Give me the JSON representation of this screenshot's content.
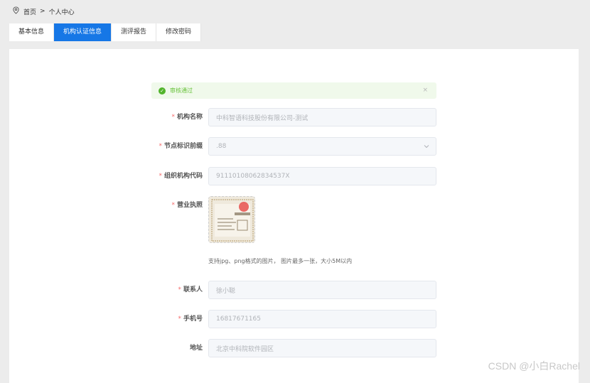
{
  "breadcrumb": {
    "home": "首页",
    "separator": ">",
    "current": "个人中心"
  },
  "tabs": [
    {
      "label": "基本信息",
      "active": false
    },
    {
      "label": "机构认证信息",
      "active": true
    },
    {
      "label": "测评报告",
      "active": false
    },
    {
      "label": "修改密码",
      "active": false
    }
  ],
  "alert": {
    "text": "审核通过",
    "close": "×"
  },
  "form": {
    "org_name": {
      "label": "机构名称",
      "required": "*",
      "value": "中科智语科技股份有限公司-测试"
    },
    "node_prefix": {
      "label": "节点标识前缀",
      "required": "*",
      "value": ".88"
    },
    "org_code": {
      "label": "组织机构代码",
      "required": "*",
      "value": "91110108062834537X"
    },
    "license": {
      "label": "营业执照",
      "required": "*",
      "hint": "支持jpg、png格式的图片， 图片最多一张，大小5M以内"
    },
    "contact": {
      "label": "联系人",
      "required": "*",
      "value": "徐小聪"
    },
    "phone": {
      "label": "手机号",
      "required": "*",
      "value": "16817671165"
    },
    "address": {
      "label": "地址",
      "value": "北京中科院软件园区"
    }
  },
  "watermark": "CSDN @小白Rachel",
  "colors": {
    "accent": "#1677e6",
    "success": "#52b42c",
    "required": "#f56c6c"
  }
}
